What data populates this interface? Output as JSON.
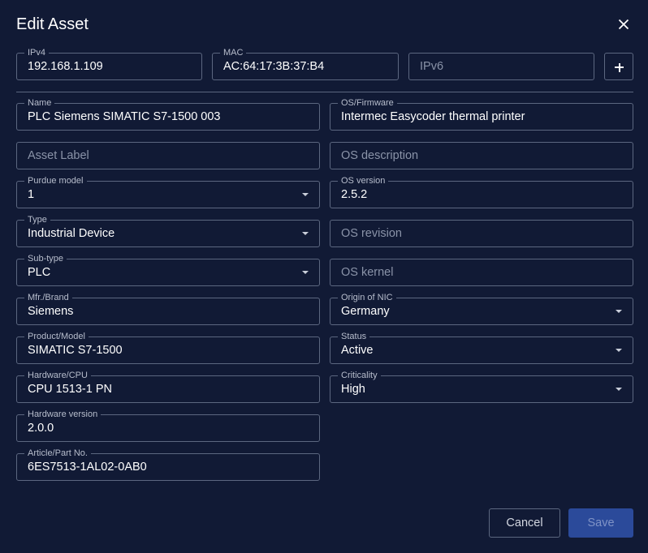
{
  "dialog": {
    "title": "Edit Asset",
    "close_icon": "close-icon"
  },
  "network": {
    "ipv4": {
      "label": "IPv4",
      "value": "192.168.1.109"
    },
    "mac": {
      "label": "MAC",
      "value": "AC:64:17:3B:37:B4"
    },
    "ipv6": {
      "placeholder": "IPv6"
    },
    "add_icon": "plus-icon"
  },
  "left": {
    "name": {
      "label": "Name",
      "value": "PLC Siemens SIMATIC S7-1500 003"
    },
    "asset_label": {
      "placeholder": "Asset Label"
    },
    "purdue_model": {
      "label": "Purdue model",
      "value": "1"
    },
    "type": {
      "label": "Type",
      "value": "Industrial Device"
    },
    "sub_type": {
      "label": "Sub-type",
      "value": "PLC"
    },
    "brand": {
      "label": "Mfr./Brand",
      "value": "Siemens"
    },
    "product_model": {
      "label": "Product/Model",
      "value": "SIMATIC S7-1500"
    },
    "hardware_cpu": {
      "label": "Hardware/CPU",
      "value": "CPU 1513-1 PN"
    },
    "hardware_version": {
      "label": "Hardware version",
      "value": "2.0.0"
    },
    "part_no": {
      "label": "Article/Part No.",
      "value": "6ES7513-1AL02-0AB0"
    }
  },
  "right": {
    "os_firmware": {
      "label": "OS/Firmware",
      "value": "Intermec Easycoder thermal printer"
    },
    "os_description": {
      "placeholder": "OS description"
    },
    "os_version": {
      "label": "OS version",
      "value": "2.5.2"
    },
    "os_revision": {
      "placeholder": "OS revision"
    },
    "os_kernel": {
      "placeholder": "OS kernel"
    },
    "origin_nic": {
      "label": "Origin of NIC",
      "value": "Germany"
    },
    "status": {
      "label": "Status",
      "value": "Active"
    },
    "criticality": {
      "label": "Criticality",
      "value": "High"
    }
  },
  "footer": {
    "cancel_label": "Cancel",
    "save_label": "Save"
  },
  "colors": {
    "background": "#111a35",
    "border": "#5c6780",
    "save_button": "#2b4a9a"
  }
}
